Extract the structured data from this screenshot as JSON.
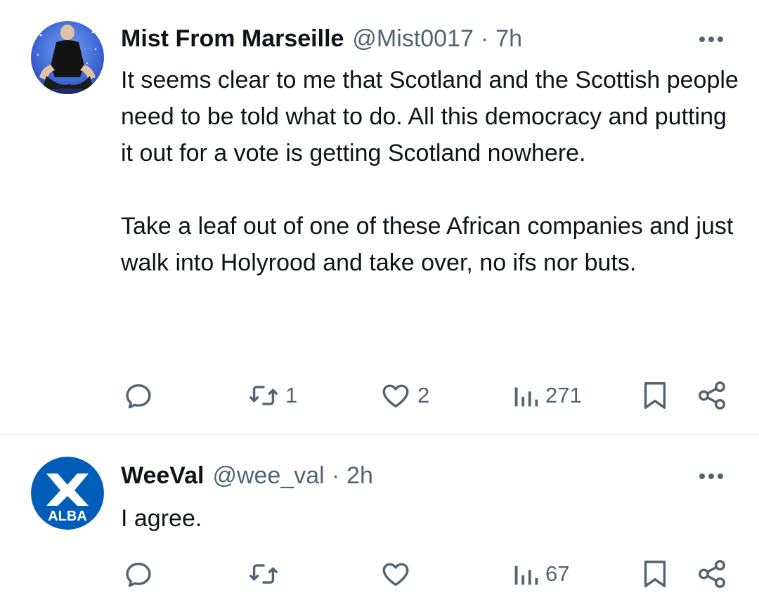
{
  "tweets": [
    {
      "name": "Mist From Marseille",
      "handle": "@Mist0017",
      "dot": "·",
      "time": "7h",
      "paragraphs": [
        "It seems clear to me that Scotland and the Scottish people need to be told what to do.  All this democracy and putting it out for a vote is getting Scotland nowhere.",
        "Take a leaf out of one of these African companies and just walk into Holyrood and take over,  no ifs nor buts."
      ],
      "reposts": "1",
      "likes": "2",
      "views": "271"
    },
    {
      "name": "WeeVal",
      "handle": "@wee_val",
      "dot": "·",
      "time": "2h",
      "paragraphs": [
        "I agree."
      ],
      "reposts": "",
      "likes": "",
      "views": "67",
      "avatar_text": "ALBA"
    }
  ],
  "colors": {
    "text": "#0f1419",
    "secondary": "#536471",
    "alba_blue": "#005EB8",
    "divider": "#eff3f4"
  },
  "icons": [
    "more-icon",
    "reply-icon",
    "repost-icon",
    "like-icon",
    "views-icon",
    "bookmark-icon",
    "share-icon"
  ]
}
